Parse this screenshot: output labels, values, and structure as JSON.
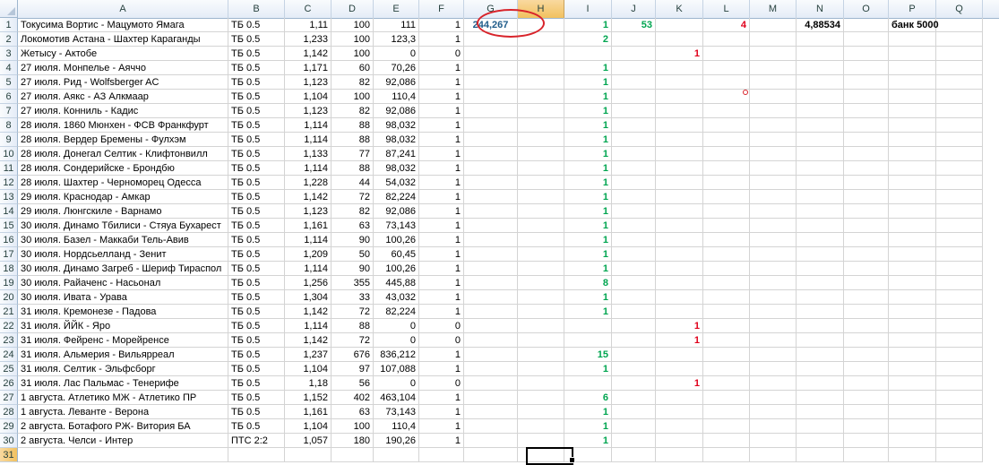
{
  "columns": [
    "A",
    "B",
    "C",
    "D",
    "E",
    "F",
    "G",
    "H",
    "I",
    "J",
    "K",
    "L",
    "M",
    "N",
    "O",
    "P",
    "Q"
  ],
  "selected_column": "H",
  "selected_row": "31",
  "row_numbers": [
    "1",
    "2",
    "3",
    "4",
    "5",
    "6",
    "7",
    "8",
    "9",
    "10",
    "11",
    "12",
    "13",
    "14",
    "15",
    "16",
    "17",
    "18",
    "19",
    "20",
    "21",
    "22",
    "23",
    "24",
    "25",
    "26",
    "27",
    "28",
    "29",
    "30",
    "31"
  ],
  "rows": [
    {
      "A": "Токусима Вортис  -  Мацумото Ямага",
      "B": "ТБ 0.5",
      "C": "1,11",
      "D": "100",
      "E": "111",
      "F": "1",
      "G": "244,267",
      "I": "1",
      "J": "53",
      "L": "4",
      "N": "4,88534",
      "P": "банк 5000"
    },
    {
      "A": "Локомотив Астана - Шахтер Караганды",
      "B": "ТБ 0.5",
      "C": "1,233",
      "D": "100",
      "E": "123,3",
      "F": "1",
      "I": "2"
    },
    {
      "A": " Жетысу - Актобе",
      "B": "ТБ 0.5",
      "C": "1,142",
      "D": "100",
      "E": "0",
      "F": "0",
      "K": "1"
    },
    {
      "A": "27 июля. Монпелье - Аяччо",
      "B": "ТБ 0.5",
      "C": "1,171",
      "D": "60",
      "E": "70,26",
      "F": "1",
      "I": "1"
    },
    {
      "A": "27 июля. Рид - Wolfsberger AC",
      "B": "ТБ 0.5",
      "C": "1,123",
      "D": "82",
      "E": "92,086",
      "F": "1",
      "I": "1"
    },
    {
      "A": "27 июля. Аякс - АЗ Алкмаар",
      "B": "ТБ 0.5",
      "C": "1,104",
      "D": "100",
      "E": "110,4",
      "F": "1",
      "I": "1"
    },
    {
      "A": "27 июля. Конниль - Кадис",
      "B": "ТБ 0.5",
      "C": "1,123",
      "D": "82",
      "E": "92,086",
      "F": "1",
      "I": "1"
    },
    {
      "A": "28 июля. 1860 Мюнхен - ФСВ Франкфурт",
      "B": "ТБ 0.5",
      "C": "1,114",
      "D": "88",
      "E": "98,032",
      "F": "1",
      "I": "1"
    },
    {
      "A": "28 июля. Вердер Бремены - Фулхэм",
      "B": "ТБ 0.5",
      "C": "1,114",
      "D": "88",
      "E": "98,032",
      "F": "1",
      "I": "1"
    },
    {
      "A": "28 июля. Донегал Селтик - Клифтонвилл",
      "B": "ТБ 0.5",
      "C": "1,133",
      "D": "77",
      "E": "87,241",
      "F": "1",
      "I": "1"
    },
    {
      "A": "28 июля. Сондерийске - Брондбю",
      "B": "ТБ 0.5",
      "C": "1,114",
      "D": "88",
      "E": "98,032",
      "F": "1",
      "I": "1"
    },
    {
      "A": "28 июля.  Шахтер - Черноморец Одесса",
      "B": "ТБ 0.5",
      "C": "1,228",
      "D": "44",
      "E": "54,032",
      "F": "1",
      "I": "1"
    },
    {
      "A": "29 июля. Краснодар - Амкар",
      "B": "ТБ 0.5",
      "C": "1,142",
      "D": "72",
      "E": "82,224",
      "F": "1",
      "I": "1"
    },
    {
      "A": "29 июля. Люнгскиле - Варнамо",
      "B": "ТБ 0.5",
      "C": "1,123",
      "D": "82",
      "E": "92,086",
      "F": "1",
      "I": "1"
    },
    {
      "A": "30 июля. Динамо Тбилиси - Стяуа Бухарест",
      "B": "ТБ 0.5",
      "C": "1,161",
      "D": "63",
      "E": "73,143",
      "F": "1",
      "I": "1"
    },
    {
      "A": "30 июля. Базел - Маккаби Тель-Авив",
      "B": "ТБ 0.5",
      "C": "1,114",
      "D": "90",
      "E": "100,26",
      "F": "1",
      "I": "1"
    },
    {
      "A": "30 июля.  Нордсьелланд - Зенит",
      "B": "ТБ 0.5",
      "C": "1,209",
      "D": "50",
      "E": "60,45",
      "F": "1",
      "I": "1"
    },
    {
      "A": "30 июля. Динамо Загреб - Шериф Тираспол",
      "B": "ТБ 0.5",
      "C": "1,114",
      "D": "90",
      "E": "100,26",
      "F": "1",
      "I": "1"
    },
    {
      "A": "30 июля. Райаченс - Насьонал",
      "B": "ТБ 0.5",
      "C": "1,256",
      "D": "355",
      "E": "445,88",
      "F": "1",
      "I": "8"
    },
    {
      "A": "30 июля.  Ивата - Урава",
      "B": "ТБ 0.5",
      "C": "1,304",
      "D": "33",
      "E": "43,032",
      "F": "1",
      "I": "1"
    },
    {
      "A": "31 июля. Кремонезе - Падова",
      "B": "ТБ 0.5",
      "C": "1,142",
      "D": "72",
      "E": "82,224",
      "F": "1",
      "I": "1"
    },
    {
      "A": "31 июля. ЙЙК - Яро",
      "B": "ТБ 0.5",
      "C": "1,114",
      "D": "88",
      "E": "0",
      "F": "0",
      "K": "1"
    },
    {
      "A": "31 июля. Фейренс - Морейренсе",
      "B": "ТБ 0.5",
      "C": "1,142",
      "D": "72",
      "E": "0",
      "F": "0",
      "K": "1"
    },
    {
      "A": "31 июля.  Альмерия - Вильярреал",
      "B": "ТБ 0.5",
      "C": "1,237",
      "D": "676",
      "E": "836,212",
      "F": "1",
      "I": "15"
    },
    {
      "A": "31 июля. Селтик - Эльфсборг",
      "B": "ТБ 0.5",
      "C": "1,104",
      "D": "97",
      "E": "107,088",
      "F": "1",
      "I": "1"
    },
    {
      "A": "31 июля.  Лас Пальмас - Тенерифе",
      "B": "ТБ 0.5",
      "C": "1,18",
      "D": "56",
      "E": "0",
      "F": "0",
      "K": "1"
    },
    {
      "A": "1 августа.  Атлетико МЖ - Атлетико ПР",
      "B": "ТБ 0.5",
      "C": "1,152",
      "D": "402",
      "E": "463,104",
      "F": "1",
      "I": "6"
    },
    {
      "A": "1 августа. Леванте - Верона",
      "B": "ТБ 0.5",
      "C": "1,161",
      "D": "63",
      "E": "73,143",
      "F": "1",
      "I": "1"
    },
    {
      "A": "2 августа. Ботафого РЖ- Витория БА",
      "B": "ТБ 0.5",
      "C": "1,104",
      "D": "100",
      "E": "110,4",
      "F": "1",
      "I": "1"
    },
    {
      "A": "2 августа. Челси - Интер",
      "B": "ПТС 2:2",
      "C": "1,057",
      "D": "180",
      "E": "190,26",
      "F": "1",
      "I": "1"
    },
    {}
  ],
  "colors": {
    "green": "#00a550",
    "red": "#e0001b",
    "blue": "#1f5c8a",
    "annotation_circle": "#d8232a"
  }
}
